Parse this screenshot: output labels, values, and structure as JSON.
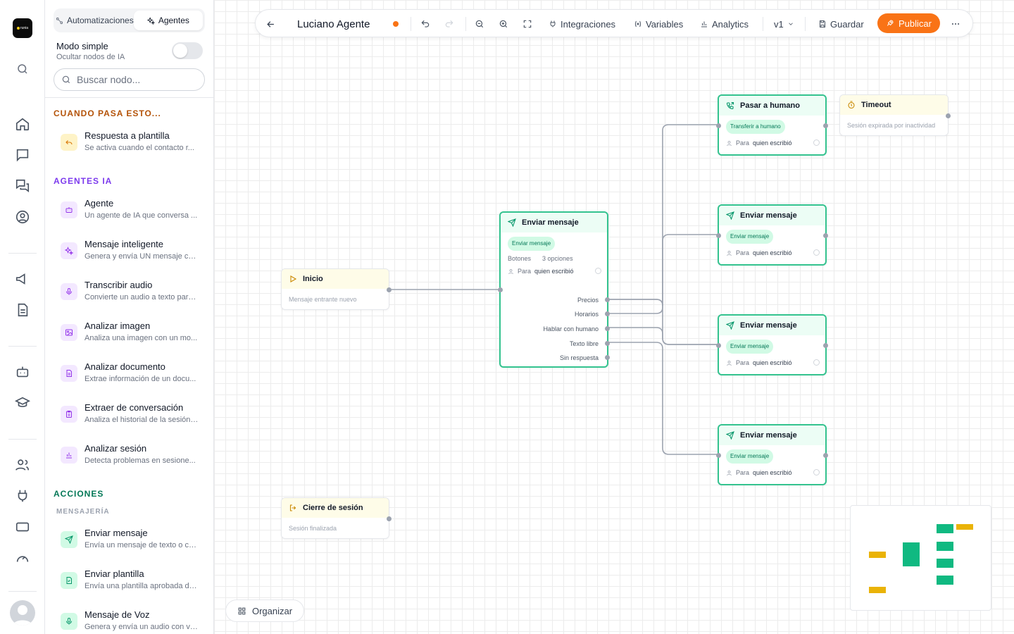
{
  "app": {
    "logo_text": "runia"
  },
  "panel": {
    "tabs": [
      {
        "label": "Automatizaciones"
      },
      {
        "label": "Agentes"
      }
    ],
    "simple_mode": {
      "title": "Modo simple",
      "subtitle": "Ocultar nodos de IA",
      "on": false
    },
    "search": {
      "placeholder": "Buscar nodo..."
    },
    "sections": {
      "trigger": "CUANDO PASA ESTO...",
      "ai": "AGENTES IA",
      "actions": "ACCIONES",
      "messaging": "MENSAJERÍA"
    },
    "trigger_items": [
      {
        "name": "Respuesta a plantilla",
        "desc": "Se activa cuando el contacto r..."
      }
    ],
    "ai_items": [
      {
        "name": "Agente",
        "desc": "Un agente de IA que conversa ..."
      },
      {
        "name": "Mensaje inteligente",
        "desc": "Genera y envía UN mensaje co..."
      },
      {
        "name": "Transcribir audio",
        "desc": "Convierte un audio a texto para..."
      },
      {
        "name": "Analizar imagen",
        "desc": "Analiza una imagen con un mo..."
      },
      {
        "name": "Analizar documento",
        "desc": "Extrae información de un docu..."
      },
      {
        "name": "Extraer de conversación",
        "desc": "Analiza el historial de la sesión ..."
      },
      {
        "name": "Analizar sesión",
        "desc": "Detecta problemas en sesione..."
      }
    ],
    "action_items": [
      {
        "name": "Enviar mensaje",
        "desc": "Envía un mensaje de texto o co..."
      },
      {
        "name": "Enviar plantilla",
        "desc": "Envía una plantilla aprobada de..."
      },
      {
        "name": "Mensaje de Voz",
        "desc": "Genera y envía un audio con vo..."
      }
    ]
  },
  "toolbar": {
    "title": "Luciano Agente",
    "integrations": "Integraciones",
    "variables": "Variables",
    "analytics": "Analytics",
    "version": "v1",
    "save": "Guardar",
    "publish": "Publicar"
  },
  "nodes": {
    "inicio": {
      "title": "Inicio",
      "sub": "Mensaje entrante nuevo"
    },
    "cierre": {
      "title": "Cierre de sesión",
      "sub": "Sesión finalizada"
    },
    "timeout": {
      "title": "Timeout",
      "sub": "Sesión expirada por inactividad"
    },
    "main": {
      "title": "Enviar mensaje",
      "badge": "Enviar mensaje",
      "meta_label": "Botones",
      "meta_value": "3 opciones",
      "who_prefix": "Para",
      "who_value": "quien escribió",
      "options": [
        "Precios",
        "Horarios",
        "Hablar con humano",
        "Texto libre",
        "Sin respuesta"
      ]
    },
    "human": {
      "title": "Pasar a humano",
      "badge": "Transferir a humano",
      "who_prefix": "Para",
      "who_value": "quien escribió"
    },
    "send_a": {
      "title": "Enviar mensaje",
      "badge": "Enviar mensaje",
      "who_prefix": "Para",
      "who_value": "quien escribió"
    },
    "send_b": {
      "title": "Enviar mensaje",
      "badge": "Enviar mensaje",
      "who_prefix": "Para",
      "who_value": "quien escribió"
    },
    "send_c": {
      "title": "Enviar mensaje",
      "badge": "Enviar mensaje",
      "who_prefix": "Para",
      "who_value": "quien escribió"
    }
  },
  "canvas": {
    "organize": "Organizar"
  },
  "colors": {
    "accent": "#f97316",
    "node_green": "#34c38f",
    "start_yellow": "#fefce8",
    "edge": "#9ca3af"
  }
}
